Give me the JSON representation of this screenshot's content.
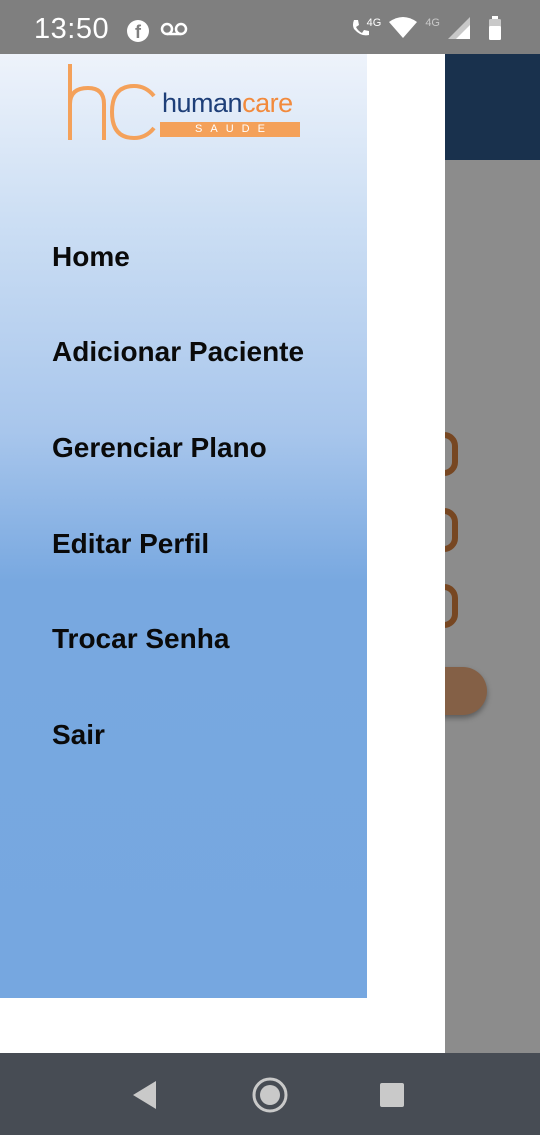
{
  "status_bar": {
    "time": "13:50",
    "network_primary": "4G",
    "network_secondary": "4G",
    "icons": [
      "facebook-icon",
      "voicemail-icon",
      "wifi-calling-icon",
      "wifi-icon",
      "signal-icon",
      "battery-icon"
    ]
  },
  "drawer": {
    "logo": {
      "monogram": "hc",
      "human": "human",
      "care": "care",
      "subtitle": "SAUDE"
    },
    "menu": [
      {
        "label": "Home"
      },
      {
        "label": "Adicionar Paciente"
      },
      {
        "label": "Gerenciar Plano"
      },
      {
        "label": "Editar Perfil"
      },
      {
        "label": "Trocar Senha"
      },
      {
        "label": "Sair"
      }
    ]
  },
  "colors": {
    "brand_blue": "#1e3f78",
    "brand_orange": "#f28a3c",
    "drawer_gradient_bottom": "#76a7e0",
    "nav_bar": "#474c54"
  },
  "nav_bar": {
    "icons": [
      "back-icon",
      "home-icon",
      "recents-icon"
    ]
  }
}
